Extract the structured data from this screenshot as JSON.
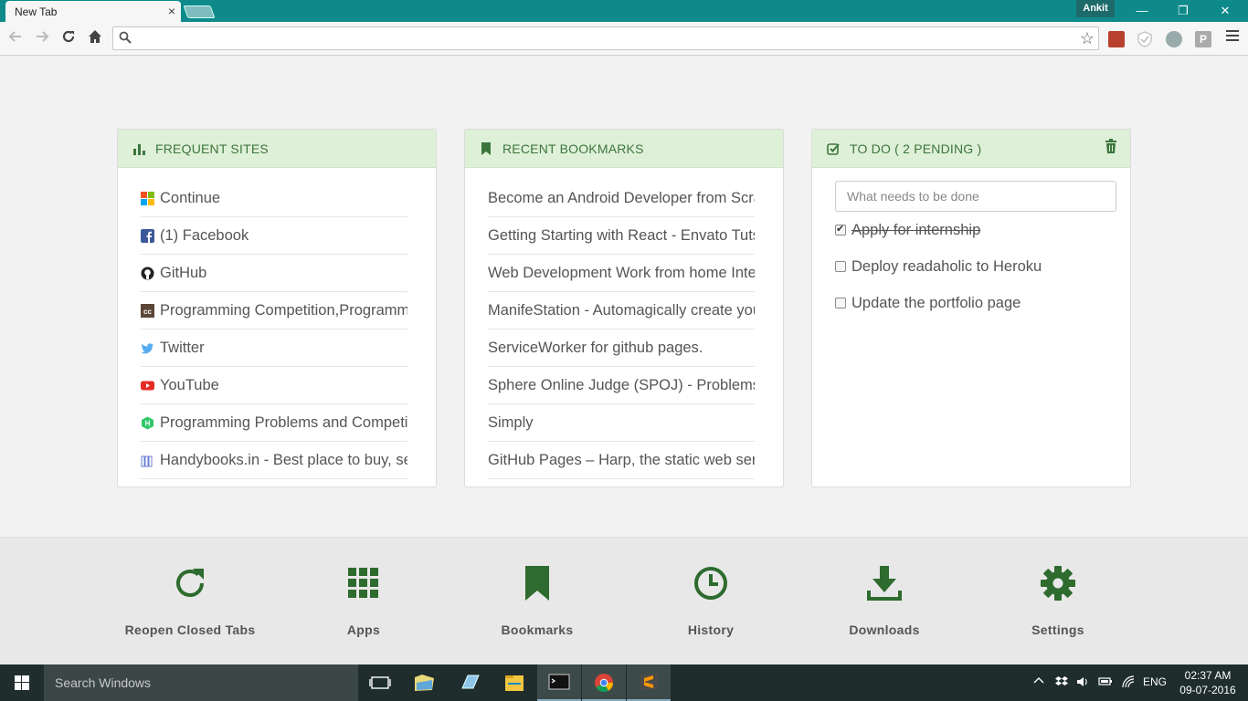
{
  "browser": {
    "tab_title": "New Tab",
    "tab_close": "×",
    "profile_name": "Ankit",
    "window_controls": {
      "minimize": "—",
      "restore": "❐",
      "close": "✕"
    },
    "omnibox": {
      "value": "",
      "placeholder": ""
    }
  },
  "cards": {
    "frequent": {
      "title": "FREQUENT SITES",
      "items": [
        {
          "label": "Continue",
          "icon": "microsoft-icon"
        },
        {
          "label": "(1) Facebook",
          "icon": "facebook-icon"
        },
        {
          "label": "GitHub",
          "icon": "github-icon"
        },
        {
          "label": "Programming Competition,Programming Contests",
          "icon": "codechef-icon"
        },
        {
          "label": "Twitter",
          "icon": "twitter-icon"
        },
        {
          "label": "YouTube",
          "icon": "youtube-icon"
        },
        {
          "label": "Programming Problems and Competitions",
          "icon": "hackerrank-icon"
        },
        {
          "label": "Handybooks.in - Best place to buy, sell books",
          "icon": "handybooks-icon"
        }
      ]
    },
    "bookmarks": {
      "title": "RECENT BOOKMARKS",
      "items": [
        "Become an Android Developer from Scratch",
        "Getting Starting with React - Envato Tuts+",
        "Web Development Work from home Internship",
        "ManifeStation - Automagically create your manifest",
        "ServiceWorker for github pages.",
        "Sphere Online Judge (SPOJ) - Problems",
        "Simply",
        "GitHub Pages – Harp, the static web server"
      ]
    },
    "todo": {
      "title": "TO DO ( 2 PENDING )",
      "input_placeholder": "What needs to be done",
      "items": [
        {
          "label": "Apply for internship",
          "done": true
        },
        {
          "label": "Deploy readaholic to Heroku",
          "done": false
        },
        {
          "label": "Update the portfolio page",
          "done": false
        }
      ]
    }
  },
  "shortcuts": [
    {
      "label": "Reopen Closed Tabs",
      "icon": "reopen-icon"
    },
    {
      "label": "Apps",
      "icon": "apps-grid-icon"
    },
    {
      "label": "Bookmarks",
      "icon": "bookmark-icon"
    },
    {
      "label": "History",
      "icon": "clock-icon"
    },
    {
      "label": "Downloads",
      "icon": "download-icon"
    },
    {
      "label": "Settings",
      "icon": "gear-icon"
    }
  ],
  "taskbar": {
    "search_text": "Search Windows",
    "language": "ENG",
    "time": "02:37 AM",
    "date": "09-07-2016"
  },
  "colors": {
    "accent_green": "#3c763d",
    "header_green": "#dff0d8",
    "shortcut_green": "#2e6b2e",
    "titlebar_teal": "#0e8a8a"
  }
}
